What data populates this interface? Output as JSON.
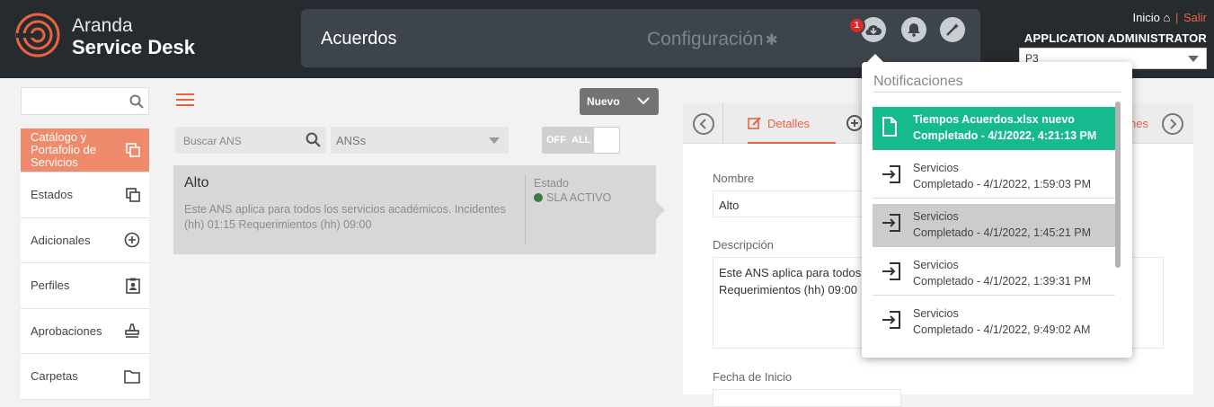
{
  "app": {
    "brand_line1": "Aranda",
    "brand_line2": "Service Desk",
    "section_title": "Acuerdos",
    "config_label": "Configuración",
    "download_badge": "1",
    "links": {
      "home": "Inicio",
      "logout": "Salir",
      "separator": "|"
    },
    "user_name": "APPLICATION ADMINISTRATOR",
    "project_value": "P3"
  },
  "sidebar": {
    "search_placeholder": "",
    "items": [
      {
        "label": "Catálogo y Portafolio de Servicios",
        "icon": "copy-icon",
        "active": true
      },
      {
        "label": "Estados",
        "icon": "copy-icon"
      },
      {
        "label": "Adicionales",
        "icon": "plus-circle-icon"
      },
      {
        "label": "Perfiles",
        "icon": "clipboard-user-icon"
      },
      {
        "label": "Aprobaciones",
        "icon": "stamp-icon"
      },
      {
        "label": "Carpetas",
        "icon": "folder-icon"
      }
    ]
  },
  "list": {
    "new_button": "Nuevo",
    "search_placeholder": "Buscar ANS",
    "filter_value": "ANSs",
    "toggle_off": "OFF",
    "toggle_all": "ALL",
    "items": [
      {
        "name": "Alto",
        "description": "Este ANS aplica para todos los servicios académicos. Incidentes (hh) 01:15 Requerimientos (hh) 09:00",
        "status_label": "Estado",
        "status_value": "SLA ACTIVO"
      }
    ]
  },
  "detail": {
    "tab_details": "Detalles",
    "tab_fragment": "nes",
    "name_label": "Nombre",
    "name_value": "Alto",
    "description_label": "Descripción",
    "description_value": "Este ANS aplica para todos\nRequerimientos (hh) 09:00",
    "start_date_label": "Fecha de Inicio"
  },
  "notifications": {
    "title": "Notificaciones",
    "items": [
      {
        "title": "Tiempos Acuerdos.xlsx nuevo",
        "status": "Completado - 4/1/2022, 4:21:13 PM",
        "icon": "file-icon"
      },
      {
        "title": "Servicios",
        "status": "Completado - 4/1/2022, 1:59:03 PM",
        "icon": "import-icon"
      },
      {
        "title": "Servicios",
        "status": "Completado - 4/1/2022, 1:45:21 PM",
        "icon": "import-icon"
      },
      {
        "title": "Servicios",
        "status": "Completado - 4/1/2022, 1:39:31 PM",
        "icon": "import-icon"
      },
      {
        "title": "Servicios",
        "status": "Completado - 4/1/2022, 9:49:02 AM",
        "icon": "import-icon"
      }
    ]
  },
  "colors": {
    "topbar": "#262b30",
    "accent": "#e8633f",
    "sidebar_active": "#f08a6c",
    "notification_new": "#16ba8e",
    "status_active": "#3a7d44"
  }
}
